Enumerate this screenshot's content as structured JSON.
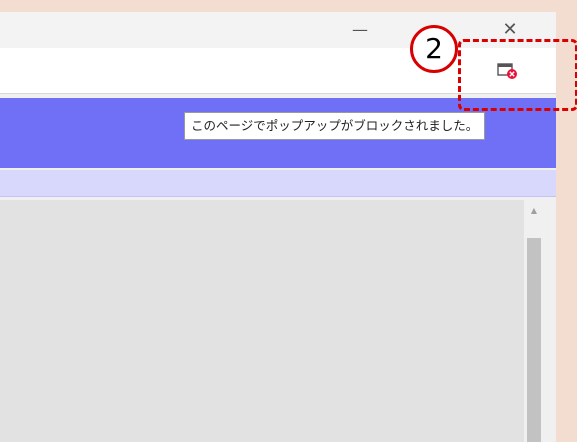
{
  "window": {
    "minimize_glyph": "—",
    "close_glyph": "✕"
  },
  "addressbar": {
    "popup_blocked_icon": "popup-blocked-icon"
  },
  "tooltip": {
    "text": "このページでポップアップがブロックされました。"
  },
  "annotation": {
    "step_number": "2",
    "color": "#d80000"
  },
  "scrollbar": {
    "up_arrow": "▲"
  },
  "colors": {
    "page_background": "#f3dcd0",
    "nav_band": "#7070f7",
    "sub_band": "#d8d8fc",
    "content": "#e2e2e2",
    "blocked_badge": "#e8113a"
  }
}
